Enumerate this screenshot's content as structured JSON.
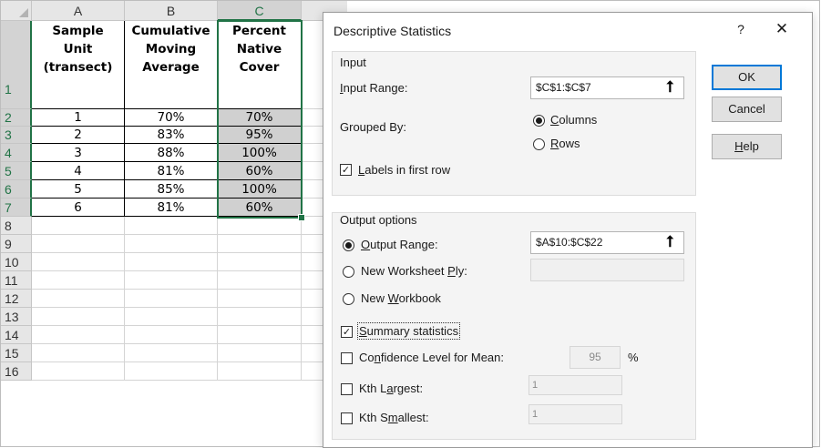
{
  "spreadsheet": {
    "columns": [
      "A",
      "B",
      "C"
    ],
    "rows": [
      "1",
      "2",
      "3",
      "4",
      "5",
      "6",
      "7",
      "8",
      "9",
      "10",
      "11",
      "12",
      "13",
      "14",
      "15",
      "16"
    ],
    "header_cells": [
      [
        "Sample",
        "Unit",
        "(transect)"
      ],
      [
        "Cumulative",
        "Moving",
        "Average"
      ],
      [
        "Percent",
        "Native",
        "Cover"
      ]
    ],
    "data": [
      [
        "1",
        "70%",
        "70%"
      ],
      [
        "2",
        "83%",
        "95%"
      ],
      [
        "3",
        "88%",
        "100%"
      ],
      [
        "4",
        "81%",
        "60%"
      ],
      [
        "5",
        "85%",
        "100%"
      ],
      [
        "6",
        "81%",
        "60%"
      ]
    ],
    "selected_column": "C",
    "selected_rows": "1-7"
  },
  "dialog": {
    "title": "Descriptive Statistics",
    "help_glyph": "?",
    "close_glyph": "✕",
    "input": {
      "group_label": "Input",
      "input_range_label": "Input Range:",
      "input_range_accel": "I",
      "input_range_rest": "nput Range:",
      "input_range_value": "$C$1:$C$7",
      "grouped_by_label": "Grouped By:",
      "columns_accel": "C",
      "columns_rest": "olumns",
      "columns_selected": true,
      "rows_accel": "R",
      "rows_rest": "ows",
      "labels_accel": "L",
      "labels_rest": "abels in first row",
      "labels_checked": true
    },
    "output": {
      "group_label": "Output options",
      "output_range_accel": "O",
      "output_range_rest": "utput Range:",
      "output_range_value": "$A$10:$C$22",
      "output_range_selected": true,
      "new_worksheet_pre": "New Worksheet ",
      "new_worksheet_accel": "P",
      "new_worksheet_post": "ly:",
      "new_worksheet_value": "",
      "new_workbook_pre": "New ",
      "new_workbook_accel": "W",
      "new_workbook_post": "orkbook",
      "summary_accel": "S",
      "summary_rest": "ummary statistics",
      "summary_checked": true,
      "confidence_pre": "Co",
      "confidence_accel": "n",
      "confidence_post": "fidence Level for Mean:",
      "confidence_checked": false,
      "confidence_value": "95",
      "percent_sign": "%",
      "kth_largest_pre": "Kth L",
      "kth_largest_accel": "a",
      "kth_largest_post": "rgest:",
      "kth_largest_checked": false,
      "kth_largest_value": "1",
      "kth_smallest_pre": "Kth S",
      "kth_smallest_accel": "m",
      "kth_smallest_post": "allest:",
      "kth_smallest_checked": false,
      "kth_smallest_value": "1"
    },
    "buttons": {
      "ok": "OK",
      "cancel": "Cancel",
      "help_accel": "H",
      "help_rest": "elp"
    },
    "icons": {
      "range_selector": "collapse-dialog-arrow-icon",
      "range_glyph": "⭡"
    }
  }
}
